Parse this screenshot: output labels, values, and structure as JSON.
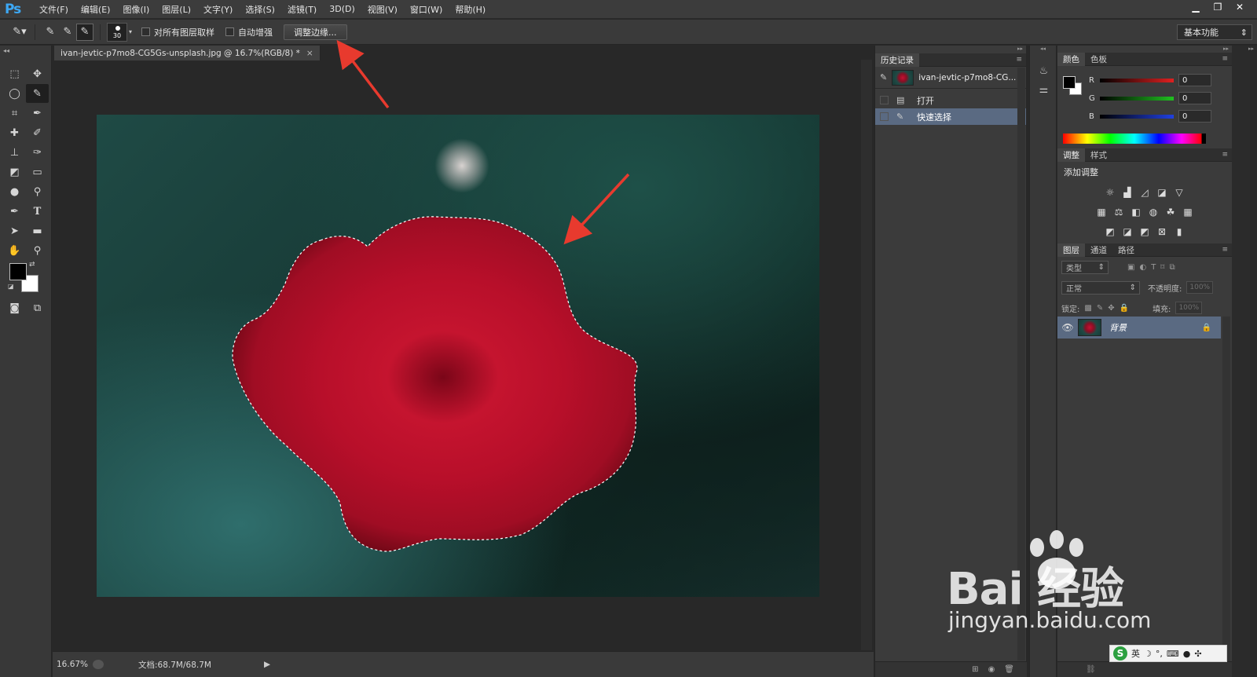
{
  "app": {
    "logo": "Ps"
  },
  "menu": [
    "文件(F)",
    "编辑(E)",
    "图像(I)",
    "图层(L)",
    "文字(Y)",
    "选择(S)",
    "滤镜(T)",
    "3D(D)",
    "视图(V)",
    "窗口(W)",
    "帮助(H)"
  ],
  "window_controls": {
    "minimize": "▁",
    "restore": "❐",
    "close": "✕"
  },
  "options": {
    "brush_size": "30",
    "sample_all_layers": "对所有图层取样",
    "auto_enhance": "自动增强",
    "refine_edge": "调整边缘...",
    "workspace": "基本功能"
  },
  "document": {
    "tab_title": "ivan-jevtic-p7mo8-CG5Gs-unsplash.jpg @ 16.7%(RGB/8) *",
    "zoom": "16.67%",
    "doc_size": "文档:68.7M/68.7M"
  },
  "history": {
    "tabs": [
      "历史记录"
    ],
    "snapshot": "ivan-jevtic-p7mo8-CG...",
    "items": [
      {
        "label": "打开",
        "selected": false
      },
      {
        "label": "快速选择",
        "selected": true
      }
    ]
  },
  "color_panel": {
    "tabs": [
      "颜色",
      "色板"
    ],
    "channels": [
      {
        "label": "R",
        "value": "0",
        "color": "#e02020"
      },
      {
        "label": "G",
        "value": "0",
        "color": "#20c020"
      },
      {
        "label": "B",
        "value": "0",
        "color": "#2040e0"
      }
    ]
  },
  "adjustments": {
    "tabs": [
      "调整",
      "样式"
    ],
    "title": "添加调整"
  },
  "layers": {
    "tabs": [
      "图层",
      "通道",
      "路径"
    ],
    "filter_kind": "类型",
    "blend_mode": "正常",
    "opacity_label": "不透明度:",
    "opacity_value": "100%",
    "lock_label": "锁定:",
    "fill_label": "填充:",
    "fill_value": "100%",
    "items": [
      {
        "name": "背景",
        "locked": true
      }
    ]
  },
  "watermark": {
    "brand": "Bai  经验",
    "url": "jingyan.baidu.com"
  },
  "ime": {
    "lang": "英"
  }
}
